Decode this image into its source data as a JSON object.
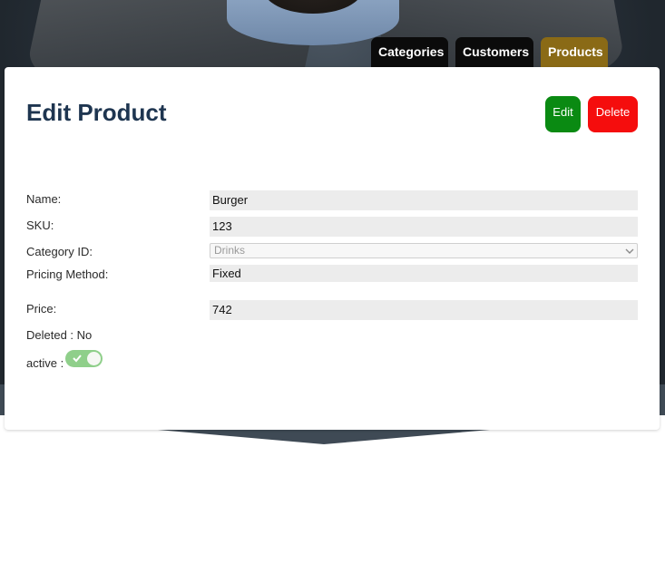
{
  "nav": {
    "tabs": [
      {
        "label": "Categories"
      },
      {
        "label": "Customers"
      },
      {
        "label": "Products"
      }
    ],
    "active_color": "#8a6a16",
    "inactive_color": "#0b0b0b"
  },
  "page": {
    "title": "Edit Product"
  },
  "actions": {
    "edit_label": "Edit",
    "edit_color": "#0a8a12",
    "delete_label": "Delete",
    "delete_color": "#f50d0d"
  },
  "form": {
    "name": {
      "label": "Name:",
      "value": "Burger"
    },
    "sku": {
      "label": "SKU:",
      "value": "123"
    },
    "category": {
      "label": "Category ID:",
      "selected": "Drinks"
    },
    "pricing": {
      "label": "Pricing Method:",
      "value": "Fixed"
    },
    "price": {
      "label": "Price:",
      "value": "742"
    },
    "deleted": {
      "text": "Deleted : No"
    },
    "active": {
      "label": "active :",
      "checked": true
    }
  }
}
